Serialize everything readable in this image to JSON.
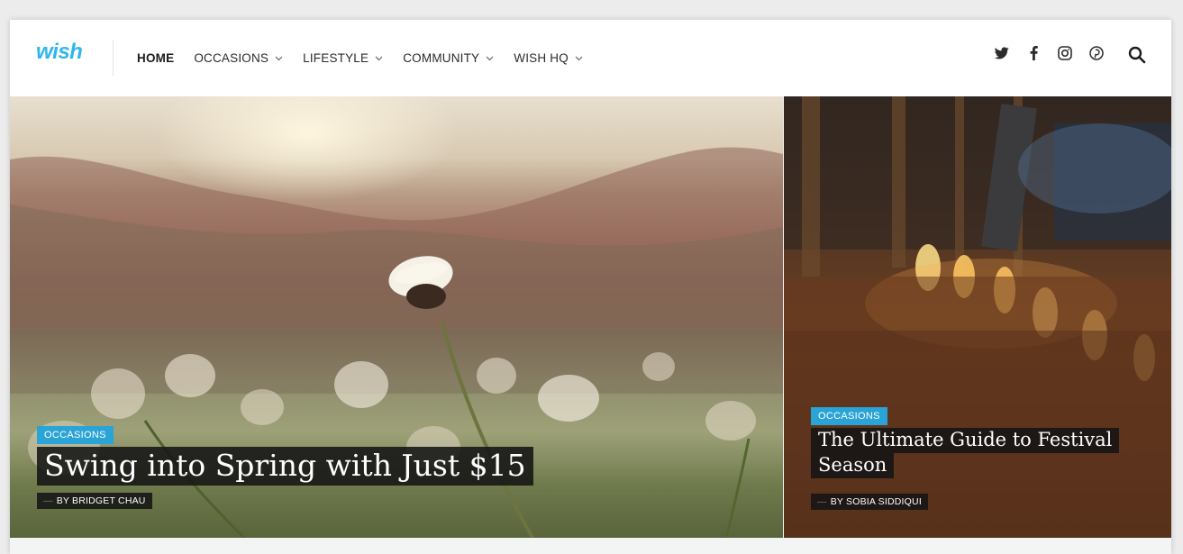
{
  "header": {
    "logo_text": "wish",
    "nav": [
      {
        "label": "HOME",
        "active": true,
        "dropdown": false
      },
      {
        "label": "OCCASIONS",
        "active": false,
        "dropdown": true
      },
      {
        "label": "LIFESTYLE",
        "active": false,
        "dropdown": true
      },
      {
        "label": "COMMUNITY",
        "active": false,
        "dropdown": true
      },
      {
        "label": "WISH HQ",
        "active": false,
        "dropdown": true
      }
    ],
    "social_icons": [
      "twitter-icon",
      "facebook-icon",
      "instagram-icon",
      "pinterest-icon"
    ],
    "search_icon": "search-icon"
  },
  "featured": {
    "main": {
      "category": "OCCASIONS",
      "title": "Swing into Spring with Just $15",
      "byline": "BY BRIDGET CHAU"
    },
    "side": {
      "category": "OCCASIONS",
      "title": "The Ultimate Guide to Festival Season",
      "byline": "BY SOBIA SIDDIQUI"
    }
  },
  "colors": {
    "brand": "#2fb7ec",
    "tag_bg": "#2aa3d6",
    "nav_text": "#2b2b2b"
  }
}
